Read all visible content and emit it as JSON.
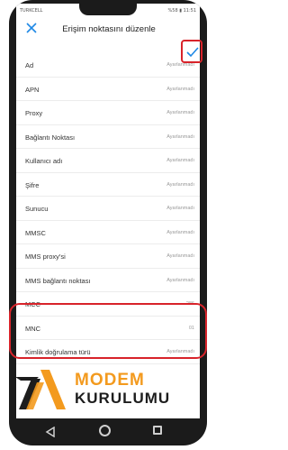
{
  "statusbar": {
    "carrier": "TURKCELL",
    "right": "%58 ▮ 11:51"
  },
  "appbar": {
    "title": "Erişim noktasını düzenle",
    "close_icon": "close-icon",
    "confirm_icon": "check-icon"
  },
  "rows": [
    {
      "label": "Ad",
      "value": "Ayarlanmadı"
    },
    {
      "label": "APN",
      "value": "Ayarlanmadı"
    },
    {
      "label": "Proxy",
      "value": "Ayarlanmadı"
    },
    {
      "label": "Bağlantı Noktası",
      "value": "Ayarlanmadı"
    },
    {
      "label": "Kullanıcı adı",
      "value": "Ayarlanmadı"
    },
    {
      "label": "Şifre",
      "value": "Ayarlanmadı"
    },
    {
      "label": "Sunucu",
      "value": "Ayarlanmadı"
    },
    {
      "label": "MMSC",
      "value": "Ayarlanmadı"
    },
    {
      "label": "MMS proxy'si",
      "value": "Ayarlanmadı"
    },
    {
      "label": "MMS bağlantı noktası",
      "value": "Ayarlanmadı"
    },
    {
      "label": "MCC",
      "value": "286"
    },
    {
      "label": "MNC",
      "value": "01"
    },
    {
      "label": "Kimlik doğrulama türü",
      "value": "Ayarlanmadı"
    }
  ],
  "logo": {
    "word1": "MODEM",
    "word2": "KURULUMU"
  },
  "colors": {
    "highlight": "#d8232a",
    "accent": "#1e88e5",
    "logo_orange": "#f39a1e"
  }
}
